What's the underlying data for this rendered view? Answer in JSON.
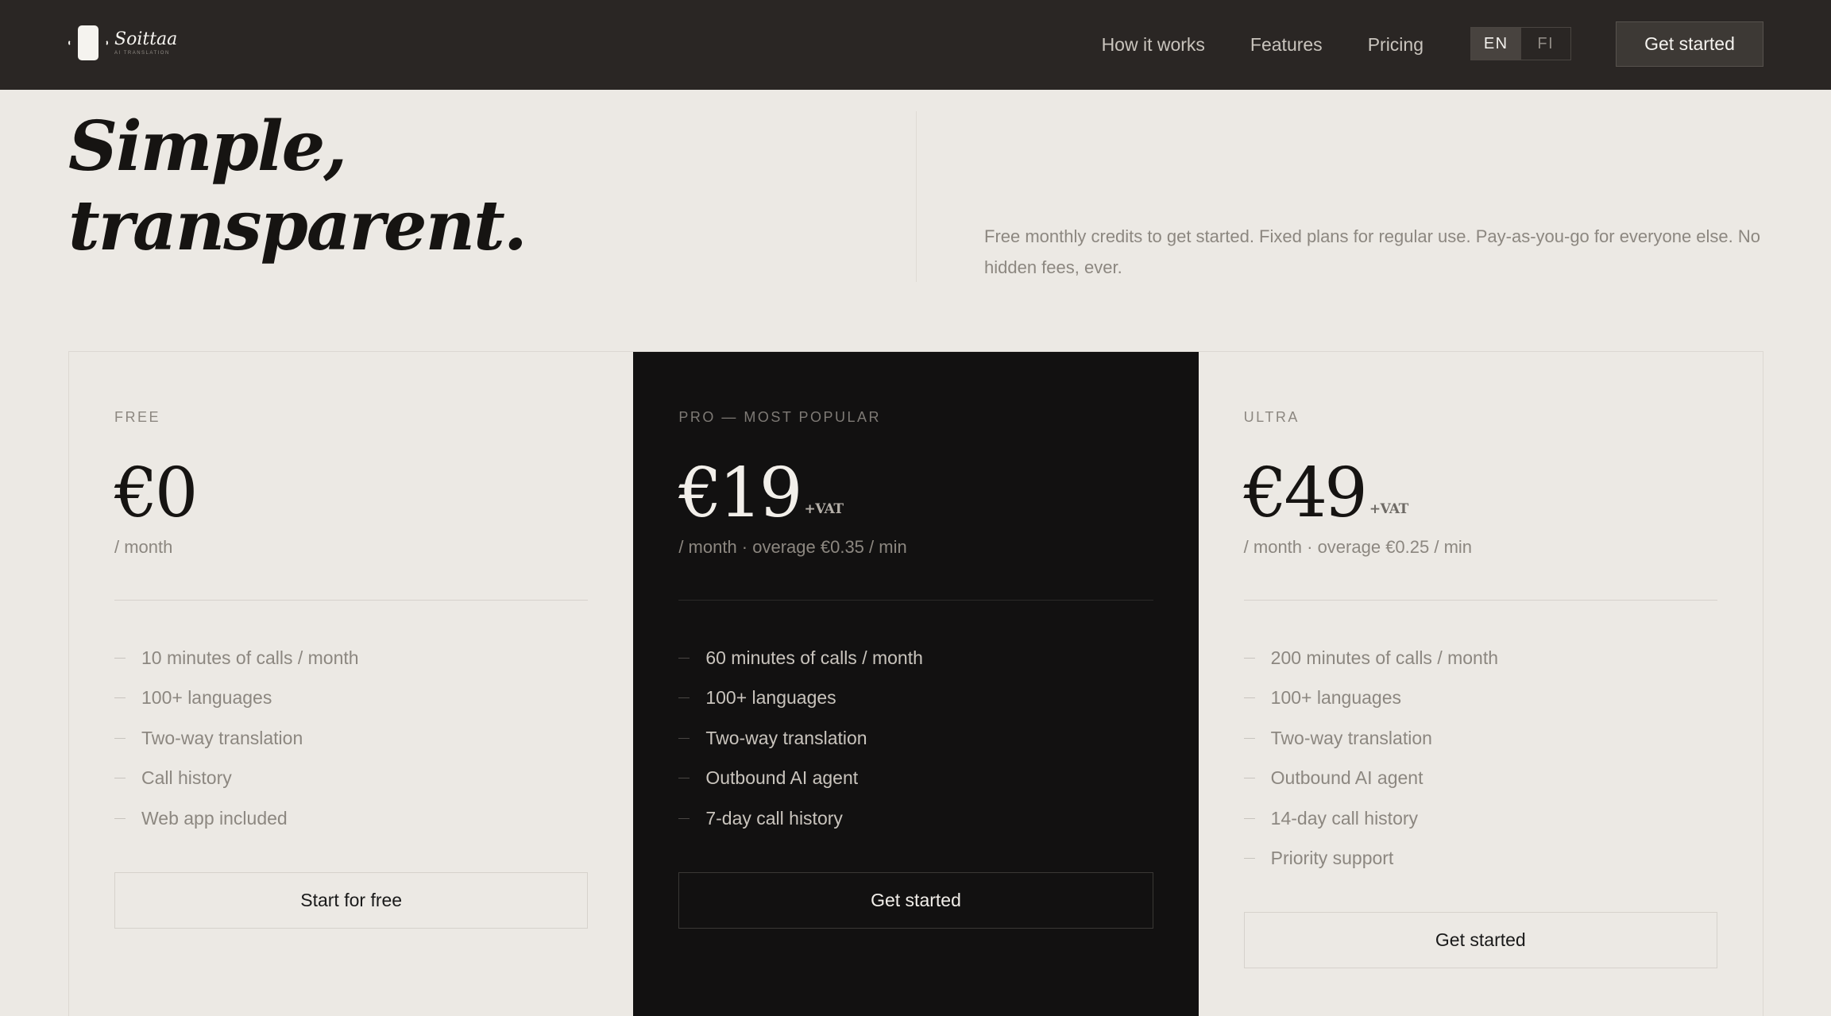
{
  "header": {
    "logo_name": "Soittaa",
    "logo_tagline": "AI TRANSLATION",
    "nav": [
      "How it works",
      "Features",
      "Pricing"
    ],
    "languages": [
      {
        "label": "EN",
        "active": true
      },
      {
        "label": "FI",
        "active": false
      }
    ],
    "cta": "Get started"
  },
  "hero": {
    "title_line1": "Simple,",
    "title_line2": "transparent.",
    "description": "Free monthly credits to get started. Fixed plans for regular use. Pay-as-you-go for everyone else. No hidden fees, ever."
  },
  "plans": [
    {
      "name": "FREE",
      "price": "€0",
      "vat": "",
      "period": "/ month",
      "features": [
        "10 minutes of calls / month",
        "100+ languages",
        "Two-way translation",
        "Call history",
        "Web app included"
      ],
      "button": "Start for free"
    },
    {
      "name": "PRO — MOST POPULAR",
      "price": "€19",
      "vat": "+VAT",
      "period": "/ month · overage €0.35 / min",
      "features": [
        "60 minutes of calls / month",
        "100+ languages",
        "Two-way translation",
        "Outbound AI agent",
        "7-day call history"
      ],
      "button": "Get started"
    },
    {
      "name": "ULTRA",
      "price": "€49",
      "vat": "+VAT",
      "period": "/ month · overage €0.25 / min",
      "features": [
        "200 minutes of calls / month",
        "100+ languages",
        "Two-way translation",
        "Outbound AI agent",
        "14-day call history",
        "Priority support"
      ],
      "button": "Get started"
    }
  ],
  "colors": {
    "header_bg": "#2a2624",
    "page_bg": "#ece9e4",
    "featured_bg": "#121111"
  }
}
